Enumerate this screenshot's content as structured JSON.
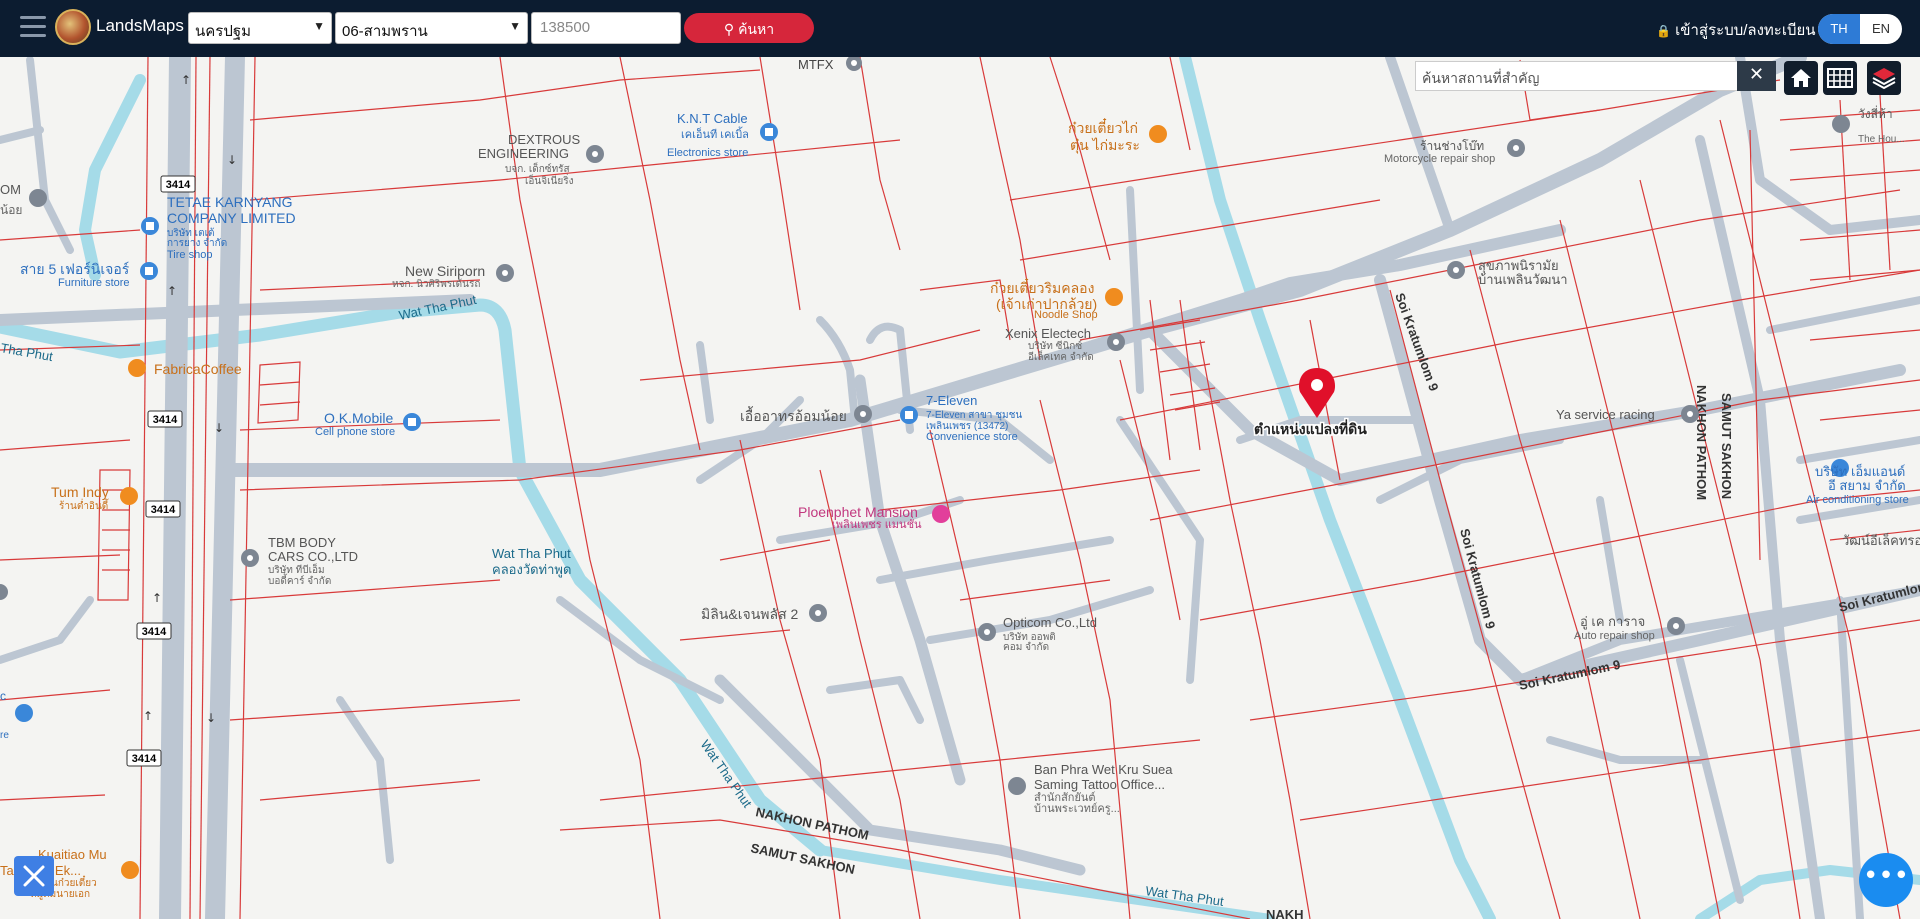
{
  "header": {
    "brand": "LandsMaps",
    "province": "นครปฐม",
    "district": "06-สามพราน",
    "parcel_no": "138500",
    "search_label": "ค้นหา",
    "login_label": "เข้าสู่ระบบ/ลงทะเบียน",
    "lang_th": "TH",
    "lang_en": "EN"
  },
  "map_tools": {
    "place_search_placeholder": "ค้นหาสถานที่สำคัญ",
    "clear_label": "✕",
    "icons": [
      "home-icon",
      "grid-icon",
      "layers-icon"
    ]
  },
  "colors": {
    "header_bg": "#0c1c30",
    "search_button": "#d6263b",
    "parcel_line": "#d83a3a",
    "canal": "#a5dbe8",
    "road": "#bcc6d2",
    "fab": "#1a8cf0"
  },
  "marker": {
    "label": "ตำแหน่งแปลงที่ดิน"
  },
  "road_labels": {
    "r3414": "3414",
    "wat_tha_phut": "Wat Tha Phut",
    "wat_tha_phut_th": "Wat Tha Phut คลองวัดท่าพูด",
    "soi_kratumlom_9": "Soi Kratumlom 9",
    "nakhon_pathom": "NAKHON PATHOM",
    "samut_sakhon": "SAMUT SAKHON",
    "tha_phut": "Tha Phut",
    "nakh": "NAKH"
  },
  "pois": [
    {
      "name": "MTFX",
      "sub": ""
    },
    {
      "name": "K.N.T Cable",
      "sub": "เคเอ็นที เคเบิ้ล",
      "cat": "Electronics store"
    },
    {
      "name": "DEXTROUS ENGINEERING",
      "sub": "บจก. เด็กซ์ทรัส เอ็นจิเนียริ่ง"
    },
    {
      "name": "ก๋วยเตี๋ยวไก่ตุ๋น ไก่มะระ"
    },
    {
      "name": "ร้านช่างโบ๊ท",
      "cat": "Motorcycle repair shop"
    },
    {
      "name": "OM",
      "sub": "น้อย"
    },
    {
      "name": "TETAE KARNYANG COMPANY LIMITED",
      "sub": "บริษัท เตเต้ การยาง จำกัด",
      "cat": "Tire shop"
    },
    {
      "name": "สาย 5 เฟอร์นิเจอร์",
      "cat": "Furniture store"
    },
    {
      "name": "New Siriporn",
      "sub": "หจก. นิวศิริพรเด้นรถ"
    },
    {
      "name": "ก๋วยเตี๋ยวริมคลอง (เจ้าเก่าปากล้วย)",
      "cat": "Noodle Shop"
    },
    {
      "name": "สุขภาพนิรามัย บ้านเพลินวัฒนา"
    },
    {
      "name": "Xenix Electech",
      "sub": "บริษัท ซีนิกซ์ อีเล็คเทค จำกัด"
    },
    {
      "name": "FabricaCoffee"
    },
    {
      "name": "O.K.Mobile",
      "cat": "Cell phone store"
    },
    {
      "name": "เอื้ออาทรอ้อมน้อย"
    },
    {
      "name": "7-Eleven",
      "sub": "7-Eleven สาขา ชุมชนเพลินเพชร (13472)",
      "cat": "Convenience store"
    },
    {
      "name": "Ya service racing"
    },
    {
      "name": "Tum Indy",
      "sub": "ร้านต่ำอินดี้"
    },
    {
      "name": "Ploenphet Mansion",
      "sub": "เพลินเพชร แมนชั่น"
    },
    {
      "name": "บริษัท เอ็มแอนด์อี สยาม จำกัด",
      "cat": "Air conditioning store"
    },
    {
      "name": "วัฒน์อีเล็คทรอ"
    },
    {
      "name": "TBM BODY CARS CO.,LTD",
      "sub": "บริษัท ทีบีเอ็ม บอดี้คาร์ จำกัด"
    },
    {
      "name": "มิลิน&เจนพลัส 2"
    },
    {
      "name": "Opticom Co.,Ltd",
      "sub": "บริษัท ออพติคอม จำกัด"
    },
    {
      "name": "อู่ เค การาจ",
      "cat": "Auto repair shop"
    },
    {
      "name": "Ban Phra Wet Kru Suea Saming Tattoo Office...",
      "sub": "บ้านพระเวทย์ครู..."
    },
    {
      "name": "Kuaitiao Mu Tang Nai Ek",
      "sub": "ร้านก๋วยเตี๋ยวหมูต้มนายเอก"
    },
    {
      "name": "วังสี่ห้า",
      "sub": "The Hou..."
    },
    {
      "name": "c",
      "cat": "re"
    }
  ],
  "fab": {
    "label": "•••"
  }
}
